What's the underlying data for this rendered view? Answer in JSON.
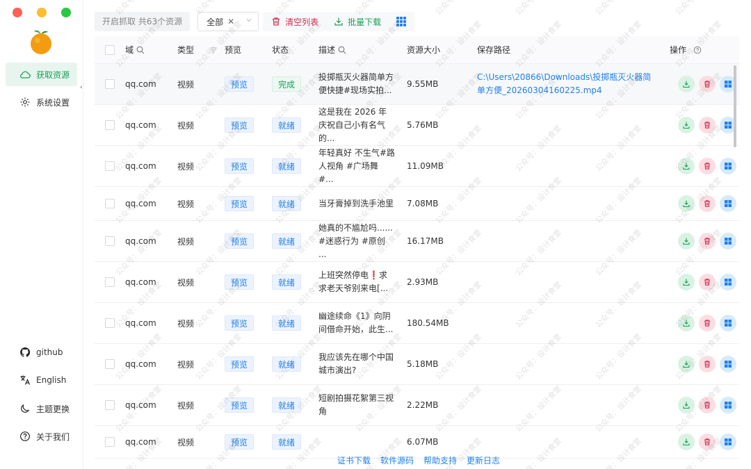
{
  "window": {
    "colors": {
      "close": "#ff5f57",
      "minimize": "#febc2e",
      "maximize": "#28c840"
    }
  },
  "sidebar": {
    "accent": "#18a058",
    "items": [
      {
        "label": "获取资源",
        "icon": "cloud-icon",
        "active": true
      },
      {
        "label": "系统设置",
        "icon": "gear-icon",
        "active": false
      }
    ],
    "bottom": [
      {
        "label": "github",
        "icon": "github-icon"
      },
      {
        "label": "English",
        "icon": "translate-icon"
      },
      {
        "label": "主题更换",
        "icon": "moon-icon"
      },
      {
        "label": "关于我们",
        "icon": "help-icon"
      }
    ]
  },
  "toolbar": {
    "status": "开启抓取 共63个资源",
    "filter_value": "全部",
    "clear_label": "清空列表",
    "batch_download_label": "批量下载"
  },
  "table": {
    "headers": {
      "domain": "域",
      "type": "类型",
      "preview": "预览",
      "status": "状态",
      "description": "描述",
      "size": "资源大小",
      "path": "保存路径",
      "ops": "操作"
    },
    "rows": [
      {
        "domain": "qq.com",
        "type": "视频",
        "preview": "预览",
        "status": "完成",
        "status_kind": "done",
        "description": "投掷瓶灭火器简单方便快捷#现场实拍...",
        "size": "9.55MB",
        "path": "C:\\Users\\20866\\Downloads\\投掷瓶灭火器简单方便_20260304160225.mp4"
      },
      {
        "domain": "qq.com",
        "type": "视频",
        "preview": "预览",
        "status": "就绪",
        "status_kind": "ready",
        "description": "这是我在 2026 年庆祝自己小有名气的...",
        "size": "5.76MB",
        "path": ""
      },
      {
        "domain": "qq.com",
        "type": "视频",
        "preview": "预览",
        "status": "就绪",
        "status_kind": "ready",
        "description": "年轻真好 不生气#路人视角 #广场舞 #...",
        "size": "11.09MB",
        "path": ""
      },
      {
        "domain": "qq.com",
        "type": "视频",
        "preview": "预览",
        "status": "就绪",
        "status_kind": "ready",
        "description": "当牙膏掉到洗手池里",
        "size": "7.08MB",
        "path": ""
      },
      {
        "domain": "qq.com",
        "type": "视频",
        "preview": "预览",
        "status": "就绪",
        "status_kind": "ready",
        "description": "她真的不尴尬吗......#迷惑行为 #原创 ...",
        "size": "16.17MB",
        "path": ""
      },
      {
        "domain": "qq.com",
        "type": "视频",
        "preview": "预览",
        "status": "就绪",
        "status_kind": "ready",
        "description": "上班突然停电❗求求老天爷别来电[...",
        "size": "2.93MB",
        "path": ""
      },
      {
        "domain": "qq.com",
        "type": "视频",
        "preview": "预览",
        "status": "就绪",
        "status_kind": "ready",
        "description": "幽途续命《1》向阴间借命开始，此生...",
        "size": "180.54MB",
        "path": ""
      },
      {
        "domain": "qq.com",
        "type": "视频",
        "preview": "预览",
        "status": "就绪",
        "status_kind": "ready",
        "description": "我应该先在哪个中国城市演出?",
        "size": "5.18MB",
        "path": ""
      },
      {
        "domain": "qq.com",
        "type": "视频",
        "preview": "预览",
        "status": "就绪",
        "status_kind": "ready",
        "description": "短剧拍摄花絮第三视角",
        "size": "2.22MB",
        "path": ""
      },
      {
        "domain": "qq.com",
        "type": "视频",
        "preview": "预览",
        "status": "就绪",
        "status_kind": "ready",
        "description": "",
        "size": "6.07MB",
        "path": ""
      }
    ]
  },
  "footer": {
    "links": [
      "证书下载",
      "软件源码",
      "帮助支持",
      "更新日志"
    ]
  },
  "watermark": "公众号：设计食堂"
}
